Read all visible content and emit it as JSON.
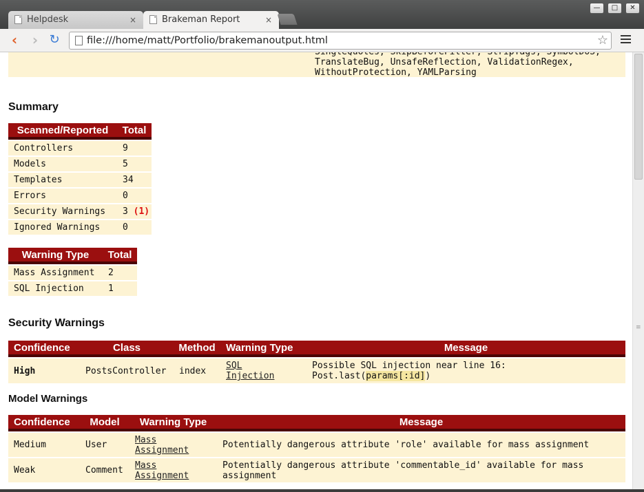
{
  "browser": {
    "tabs": [
      {
        "title": "Helpdesk",
        "close": "×"
      },
      {
        "title": "Brakeman Report",
        "close": "×"
      }
    ],
    "window_buttons": {
      "minimize": "—",
      "maximize": "□",
      "close": "✕"
    },
    "url": "file:///home/matt/Portfolio/brakemanoutput.html"
  },
  "checks_tail": "SingleQuotes, SkipBeforeFilter, StripTags, SymbolDoS,\nTranslateBug, UnsafeReflection, ValidationRegex,\nWithoutProtection, YAMLParsing",
  "summary": {
    "heading": "Summary",
    "headers": [
      "Scanned/Reported",
      "Total"
    ],
    "rows": [
      {
        "label": "Controllers",
        "total": "9"
      },
      {
        "label": "Models",
        "total": "5"
      },
      {
        "label": "Templates",
        "total": "34"
      },
      {
        "label": "Errors",
        "total": "0"
      },
      {
        "label": "Security Warnings",
        "total": "3",
        "extra": "(1)"
      },
      {
        "label": "Ignored Warnings",
        "total": "0"
      }
    ]
  },
  "warning_types": {
    "headers": [
      "Warning Type",
      "Total"
    ],
    "rows": [
      {
        "type": "Mass Assignment",
        "total": "2"
      },
      {
        "type": "SQL Injection",
        "total": "1"
      }
    ]
  },
  "security_warnings": {
    "heading": "Security Warnings",
    "headers": [
      "Confidence",
      "Class",
      "Method",
      "Warning Type",
      "Message"
    ],
    "rows": [
      {
        "confidence": "High",
        "class": "PostsController",
        "method": "index",
        "type_line1": "SQL",
        "type_line2": "Injection",
        "message_line1": "Possible SQL injection near line 16:",
        "message_code_prefix": "Post.last(",
        "message_code_hl": "params[:id]",
        "message_code_suffix": ")"
      }
    ]
  },
  "model_warnings": {
    "heading": "Model Warnings",
    "headers": [
      "Confidence",
      "Model",
      "Warning Type",
      "Message"
    ],
    "rows": [
      {
        "confidence": "Medium",
        "model": "User",
        "type_line1": "Mass",
        "type_line2": "Assignment",
        "message": "Potentially dangerous attribute 'role' available for mass assignment"
      },
      {
        "confidence": "Weak",
        "model": "Comment",
        "type_line1": "Mass",
        "type_line2": "Assignment",
        "message_line1": "Potentially dangerous attribute 'commentable_id' available for mass",
        "message_line2": "assignment"
      }
    ]
  },
  "colors": {
    "header_bg": "#9b0f0f",
    "row_bg": "#fdf3d3",
    "high": "#dd1111"
  }
}
